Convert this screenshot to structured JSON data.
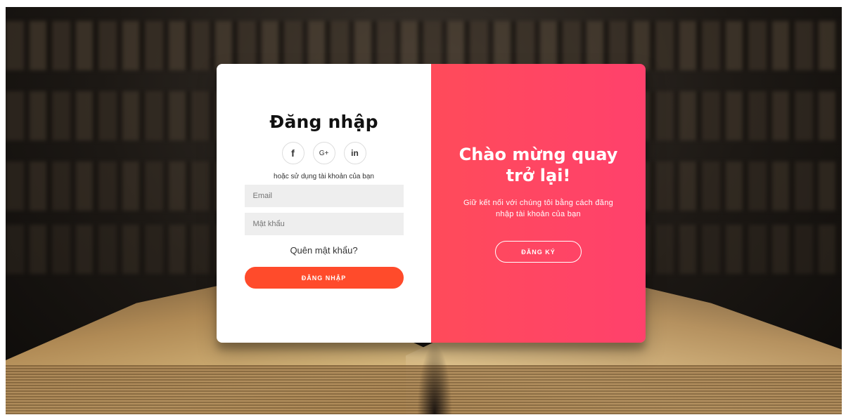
{
  "login": {
    "title": "Đăng nhập",
    "socials": [
      {
        "name": "facebook-icon",
        "glyph": "f"
      },
      {
        "name": "google-plus-icon",
        "glyph": "G+"
      },
      {
        "name": "linkedin-icon",
        "glyph": "in"
      }
    ],
    "hint": "hoặc sử dụng tài khoản của bạn",
    "email_placeholder": "Email",
    "password_placeholder": "Mật khẩu",
    "forgot": "Quên mật khẩu?",
    "submit": "ĐĂNG NHẬP"
  },
  "welcome": {
    "title": "Chào mừng quay trở lại!",
    "subtitle": "Giữ kết nối với chúng tôi bằng cách đăng nhập tài khoản của bạn",
    "register": "ĐĂNG KÝ"
  },
  "colors": {
    "accent": "#ff4b2b",
    "overlay_start": "#ff4b5a",
    "overlay_end": "#ff416c"
  }
}
